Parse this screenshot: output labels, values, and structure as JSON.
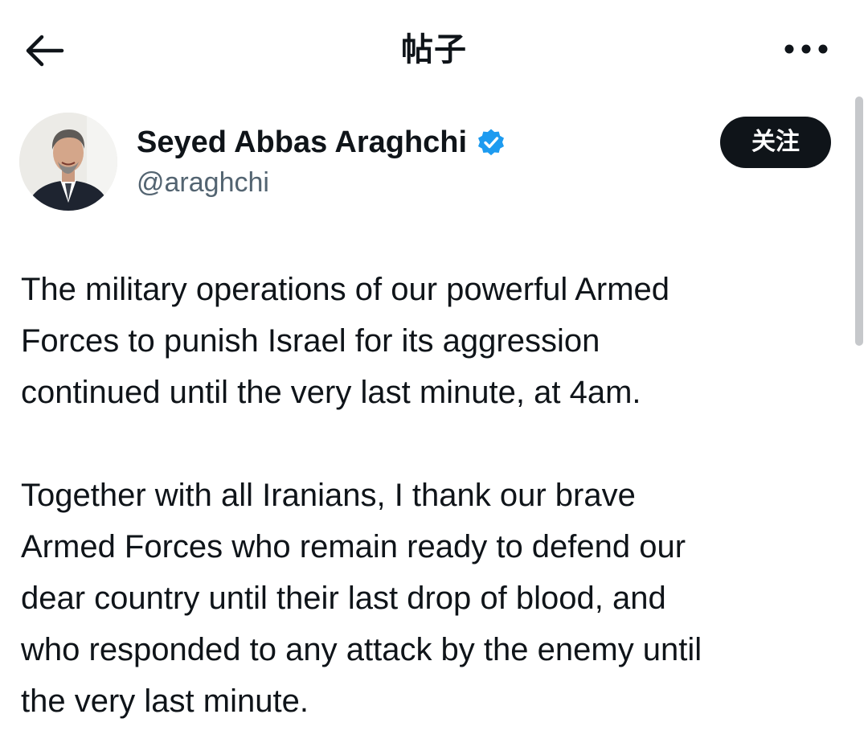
{
  "header": {
    "title": "帖子",
    "back_icon": "arrow-left-icon",
    "more_icon": "more-horizontal-icon"
  },
  "author": {
    "display_name": "Seyed Abbas Araghchi",
    "handle": "@araghchi",
    "verified": true,
    "verified_badge_color": "#1d9bf0",
    "avatar_icon": "user-avatar"
  },
  "follow_button": {
    "label": "关注",
    "background": "#0f1419",
    "text_color": "#ffffff"
  },
  "tweet": {
    "paragraphs": [
      "The military operations of our powerful Armed\nForces to punish Israel for its aggression\ncontinued until the very last minute, at 4am.",
      "Together with all Iranians, I thank our brave\nArmed Forces who remain ready to defend our\ndear country until their last drop of blood, and\nwho responded to any attack by the enemy until\nthe very last minute."
    ]
  },
  "colors": {
    "text_primary": "#0f1419",
    "text_secondary": "#536471",
    "scrollbar": "#c6c8cb"
  }
}
